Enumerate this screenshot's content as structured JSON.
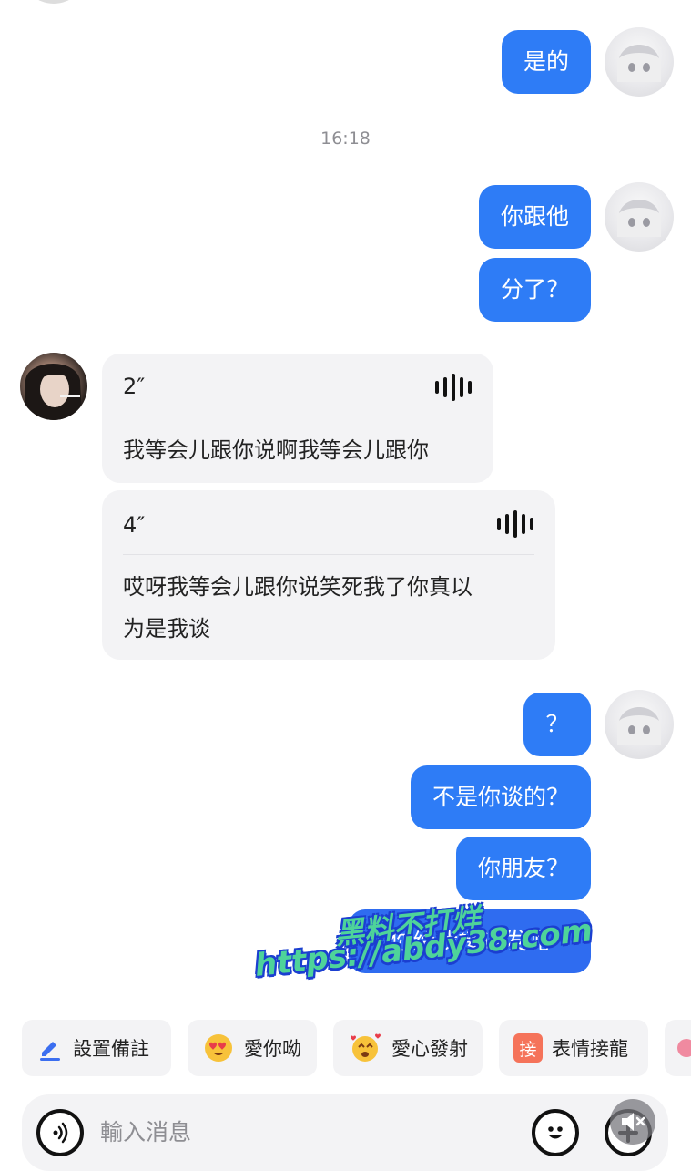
{
  "messages": {
    "m1": "是的",
    "time": "16:18",
    "m2": "你跟他",
    "m3": "分了？",
    "voice1": {
      "duration": "2″",
      "text": "我等会儿跟你说啊我等会儿跟你"
    },
    "voice2": {
      "duration": "4″",
      "text_line1": "哎呀我等会儿跟你说笑死我了你真以",
      "text_line2": "为是我谈"
    },
    "m4": "？",
    "m5": "不是你谈的？",
    "m6": "你朋友？",
    "m7": "你给我接连发呢"
  },
  "watermark": {
    "line1": "黑料不打烊",
    "line2": "https://abdy38.com"
  },
  "quick_actions": [
    {
      "label": "設置備註",
      "icon": "pencil-icon"
    },
    {
      "label": "愛你呦",
      "icon": "heart-eyes-emoji-icon"
    },
    {
      "label": "愛心發射",
      "icon": "heart-shooting-emoji-icon"
    },
    {
      "label": "表情接龍",
      "icon": "emoji-chain-icon",
      "badge": "接"
    }
  ],
  "input": {
    "placeholder": "輸入消息"
  },
  "colors": {
    "bubble_me": "#2e7cf6",
    "card_bg": "#f3f3f5"
  }
}
